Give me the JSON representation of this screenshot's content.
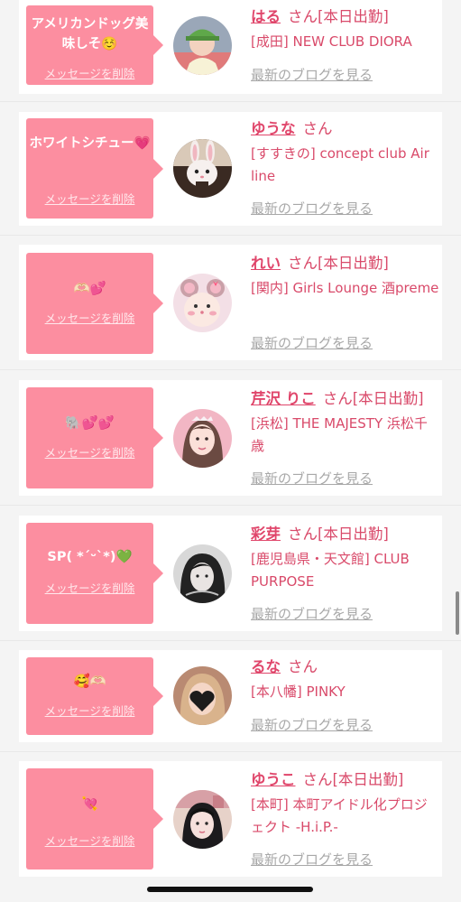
{
  "colors": {
    "bubble": "#fc8ea0",
    "name": "#e0466b",
    "text": "#d94a6a",
    "blog_link": "#a8a8a8",
    "card_bg": "#ffffff",
    "page_bg": "#f4f4f4"
  },
  "honorific": "さん",
  "delete_label": "メッセージを削除",
  "blog_label": "最新のブログを見る",
  "entries": [
    {
      "message": "アメリカンドッグ美味しそ☺️",
      "name": "はる",
      "status": "[本日出勤]",
      "shop": "[成田] NEW CLUB DIORA",
      "avatar_icon": "avatar-girl-in-cap"
    },
    {
      "message": "ホワイトシチュー💗",
      "name": "ゆうな",
      "status": "",
      "shop": "[すすきの] concept club Air line",
      "avatar_icon": "avatar-bunny-filter"
    },
    {
      "message": "🫶🏻💕",
      "name": "れい",
      "status": "[本日出勤]",
      "shop": "[関内] Girls Lounge 酒preme",
      "avatar_icon": "avatar-mouse-ears-filter"
    },
    {
      "message": "🐘💕💕",
      "name": "芹沢 りこ",
      "status": "[本日出勤]",
      "shop": "[浜松] THE MAJESTY 浜松千歳",
      "avatar_icon": "avatar-pink-selfie"
    },
    {
      "message": "SP( *´ᵕ`*)💚",
      "name": "彩芽",
      "status": "[本日出勤]",
      "shop": "[鹿児島県・天文館] CLUB PURPOSE",
      "avatar_icon": "avatar-mono-portrait"
    },
    {
      "message": "🥰🫶🏻",
      "name": "るな",
      "status": "",
      "shop": "[本八幡] PINKY",
      "avatar_icon": "avatar-heart-covered"
    },
    {
      "message": "💘",
      "name": "ゆうこ",
      "status": "[本日出勤]",
      "shop": "[本町] 本町アイドル化プロジェクト -H.i.P.-",
      "avatar_icon": "avatar-room-selfie"
    }
  ]
}
